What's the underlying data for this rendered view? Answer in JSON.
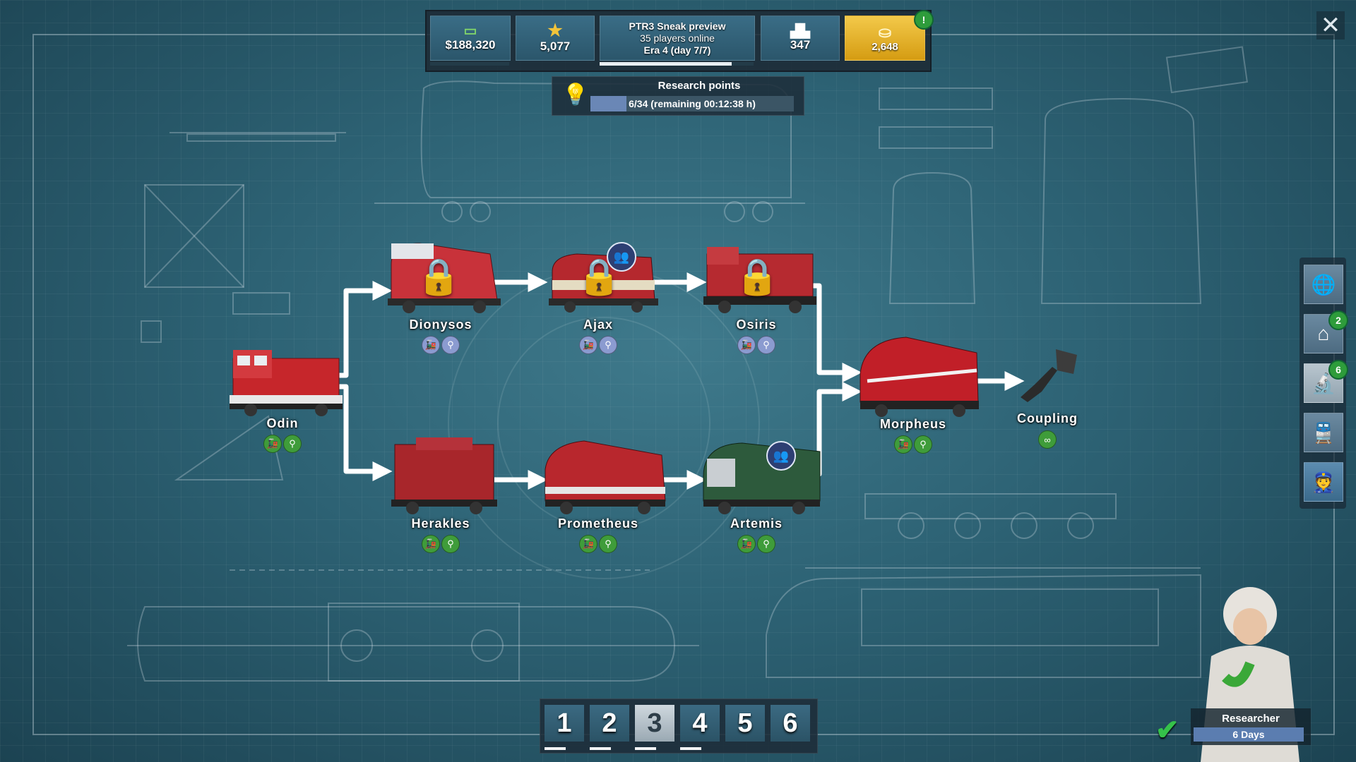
{
  "topbar": {
    "money": "$188,320",
    "prestige": "5,077",
    "server_title": "PTR3 Sneak preview",
    "players_online": "35 players online",
    "era": "Era 4 (day 7/7)",
    "rank": "347",
    "gold": "2,648",
    "gold_alert": "!",
    "era_progress": 0.86,
    "money_progress": 0
  },
  "research": {
    "title": "Research points",
    "progress_text": "6/34 (remaining 00:12:38 h)",
    "progress": 0.176
  },
  "tree": {
    "nodes": [
      {
        "name": "Odin",
        "state": "unlocked"
      },
      {
        "name": "Dionysos",
        "state": "locked"
      },
      {
        "name": "Ajax",
        "state": "locked",
        "requires_workers": true
      },
      {
        "name": "Osiris",
        "state": "locked"
      },
      {
        "name": "Herakles",
        "state": "unlocked"
      },
      {
        "name": "Prometheus",
        "state": "unlocked"
      },
      {
        "name": "Artemis",
        "state": "unlocked",
        "requires_workers": true
      },
      {
        "name": "Morpheus",
        "state": "unlocked"
      },
      {
        "name": "Coupling",
        "state": "unlocked"
      }
    ]
  },
  "sidebar": {
    "items": [
      {
        "icon": "globe-icon"
      },
      {
        "icon": "depot-icon",
        "badge": "2"
      },
      {
        "icon": "research-microscope-icon",
        "badge": "6"
      },
      {
        "icon": "add-train-icon"
      },
      {
        "icon": "conductor-avatar"
      }
    ]
  },
  "pager": {
    "pages": [
      "1",
      "2",
      "3",
      "4",
      "5",
      "6"
    ],
    "selected": 3
  },
  "researcher": {
    "title": "Researcher",
    "days": "6 Days"
  },
  "colors": {
    "background": "#2d6274",
    "gold": "#e0ad24",
    "green": "#3f9c3a",
    "locked_icon": "#8b9bd0"
  }
}
